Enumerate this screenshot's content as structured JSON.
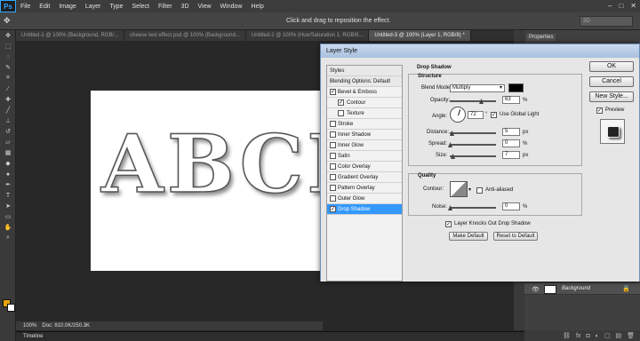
{
  "app": {
    "logo": "Ps",
    "menu": [
      "File",
      "Edit",
      "Image",
      "Layer",
      "Type",
      "Select",
      "Filter",
      "3D",
      "View",
      "Window",
      "Help"
    ],
    "window_controls": [
      "–",
      "□",
      "✕"
    ]
  },
  "options_bar": {
    "tool_glyph": "✥",
    "hint": "Click and drag to reposition the effect.",
    "workspace": "3D"
  },
  "tabs": [
    {
      "label": "Untitled-1 @ 100% (Background, RGB/...",
      "active": false
    },
    {
      "label": "cheese text effect.psd @ 100% (Background...",
      "active": false
    },
    {
      "label": "Untitled-2 @ 100% (Hue/Saturation 1, RGB/8...",
      "active": false
    },
    {
      "label": "Untitled-3 @ 100% (Layer 1, RGB/8) *",
      "active": true
    }
  ],
  "canvas": {
    "text": "ABCD"
  },
  "status": {
    "zoom": "100%",
    "doc": "Doc: 810.0K/250.3K"
  },
  "timeline": {
    "label": "Timeline"
  },
  "panels": {
    "properties_tab": "Properties",
    "layer": {
      "name": "Background",
      "eye": "👁",
      "lock": "🔒"
    },
    "footer_icons": [
      "⛓",
      "fx",
      "◘",
      "◐",
      "▢",
      "▤",
      "🗑"
    ]
  },
  "dialog": {
    "title": "Layer Style",
    "styles_header": "Styles",
    "blending": "Blending Options: Default",
    "items": [
      {
        "label": "Bevel & Emboss",
        "checked": true,
        "sub": false,
        "selected": false
      },
      {
        "label": "Contour",
        "checked": true,
        "sub": true,
        "selected": false
      },
      {
        "label": "Texture",
        "checked": false,
        "sub": true,
        "selected": false
      },
      {
        "label": "Stroke",
        "checked": false,
        "sub": false,
        "selected": false
      },
      {
        "label": "Inner Shadow",
        "checked": false,
        "sub": false,
        "selected": false
      },
      {
        "label": "Inner Glow",
        "checked": false,
        "sub": false,
        "selected": false
      },
      {
        "label": "Satin",
        "checked": false,
        "sub": false,
        "selected": false
      },
      {
        "label": "Color Overlay",
        "checked": false,
        "sub": false,
        "selected": false
      },
      {
        "label": "Gradient Overlay",
        "checked": false,
        "sub": false,
        "selected": false
      },
      {
        "label": "Pattern Overlay",
        "checked": false,
        "sub": false,
        "selected": false
      },
      {
        "label": "Outer Glow",
        "checked": false,
        "sub": false,
        "selected": false
      },
      {
        "label": "Drop Shadow",
        "checked": true,
        "sub": false,
        "selected": true
      }
    ],
    "drop_shadow": {
      "section_title": "Drop Shadow",
      "structure_title": "Structure",
      "blend_mode_label": "Blend Mode:",
      "blend_mode": "Multiply",
      "shadow_color": "#000000",
      "opacity_label": "Opacity:",
      "opacity": "63",
      "angle_label": "Angle:",
      "angle": "72",
      "degree": "°",
      "global_light_label": "Use Global Light",
      "global_light": true,
      "distance_label": "Distance:",
      "distance": "5",
      "spread_label": "Spread:",
      "spread": "0",
      "size_label": "Size:",
      "size": "7",
      "unit_px": "px",
      "unit_pct": "%",
      "quality_title": "Quality",
      "contour_label": "Contour:",
      "anti_aliased_label": "Anti-aliased",
      "anti_aliased": false,
      "noise_label": "Noise:",
      "noise": "0",
      "knocks_out_label": "Layer Knocks Out Drop Shadow",
      "knocks_out": true,
      "make_default": "Make Default",
      "reset_default": "Reset to Default"
    },
    "buttons": {
      "ok": "OK",
      "cancel": "Cancel",
      "new_style": "New Style...",
      "preview": "Preview",
      "preview_checked": true
    }
  }
}
